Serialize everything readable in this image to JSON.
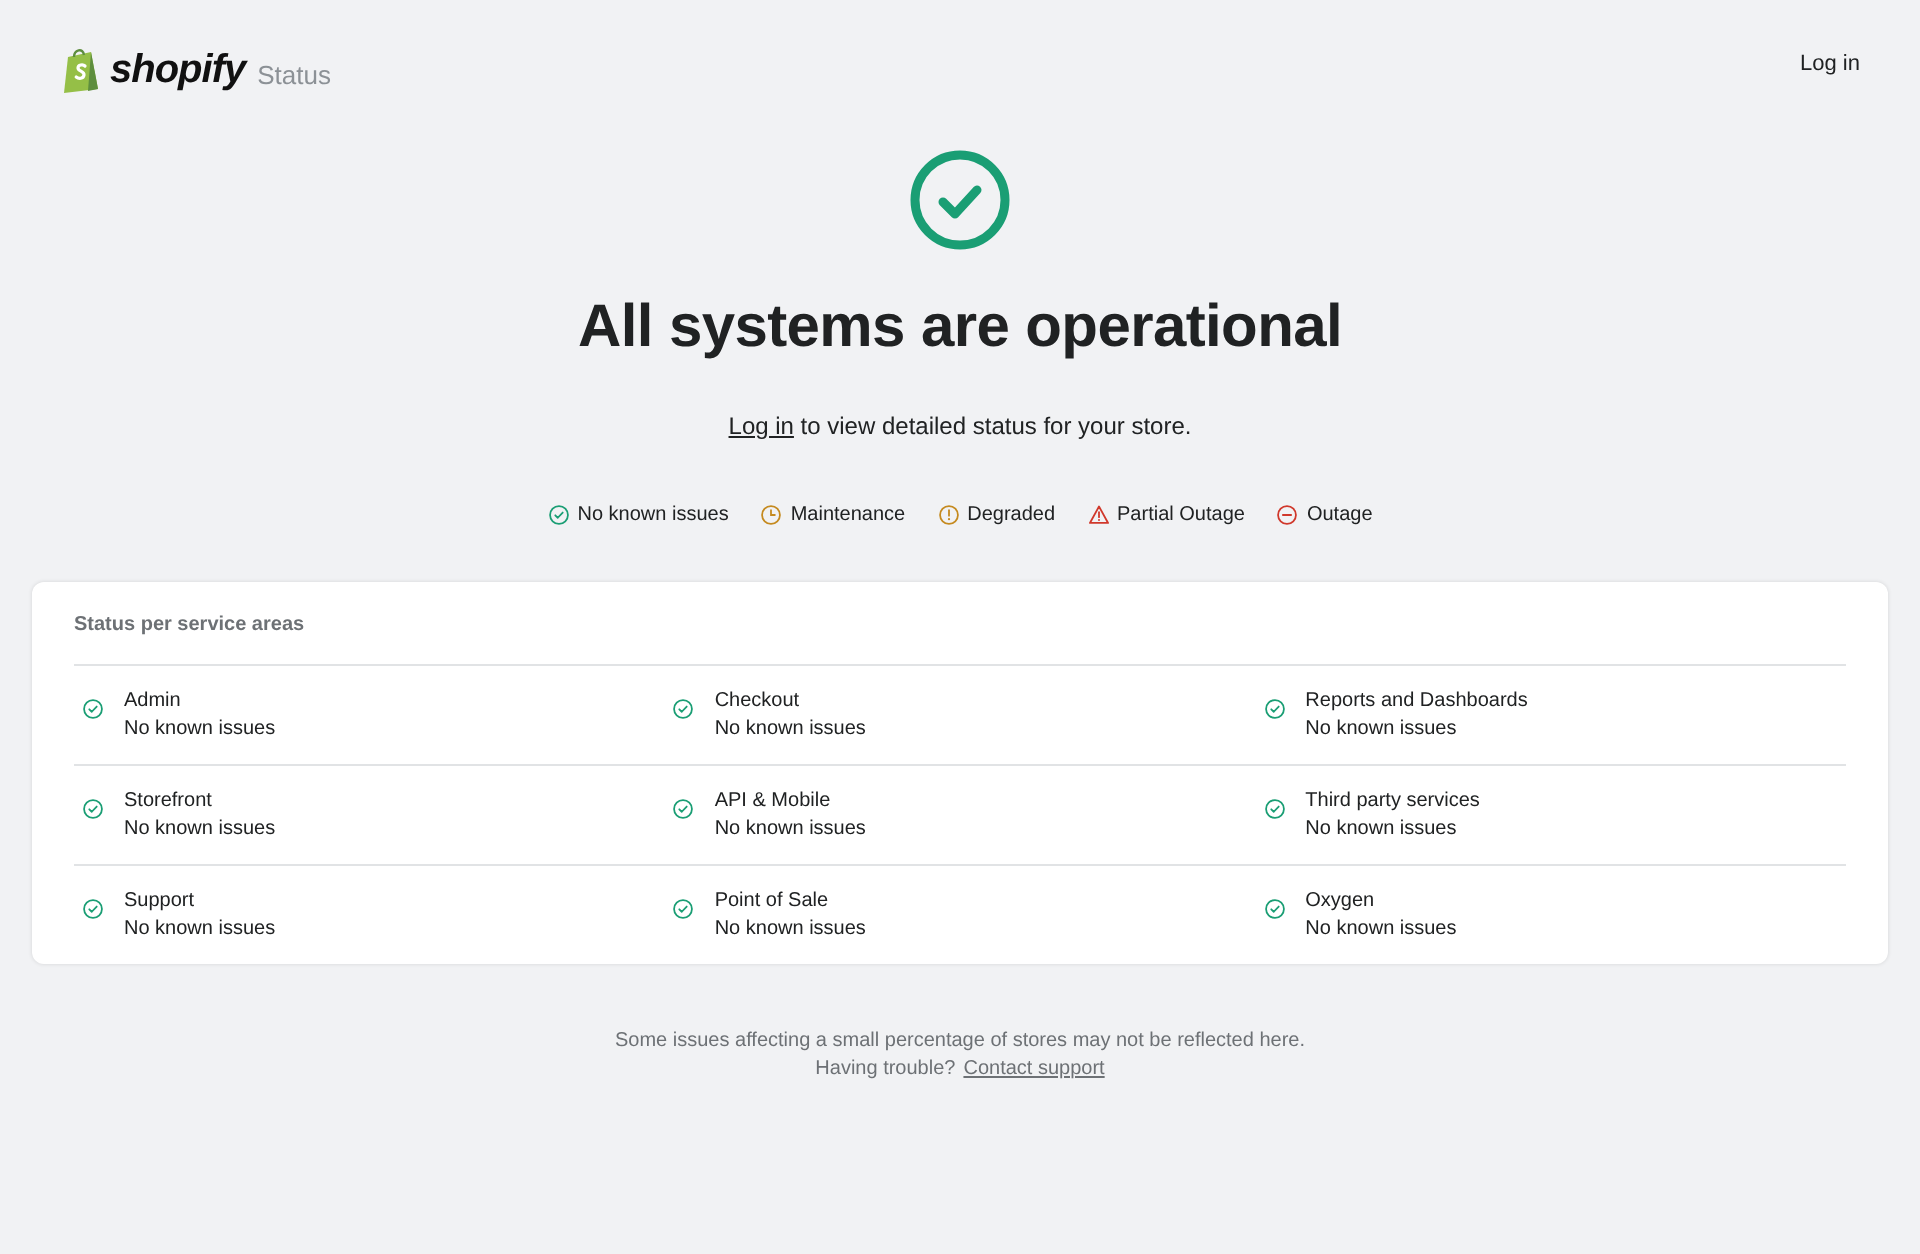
{
  "header": {
    "logo": "shopify",
    "subtitle": "Status",
    "login": "Log in"
  },
  "hero": {
    "kind": "ok",
    "title": "All systems are operational",
    "link": "Log in",
    "text": " to view detailed status for your store."
  },
  "legend": [
    {
      "kind": "ok",
      "label": "No known issues"
    },
    {
      "kind": "maintenance",
      "label": "Maintenance"
    },
    {
      "kind": "degraded",
      "label": "Degraded"
    },
    {
      "kind": "partial",
      "label": "Partial Outage"
    },
    {
      "kind": "outage",
      "label": "Outage"
    }
  ],
  "services": {
    "title": "Status per service areas",
    "items": [
      {
        "name": "Admin",
        "kind": "ok",
        "text": "No known issues"
      },
      {
        "name": "Checkout",
        "kind": "ok",
        "text": "No known issues"
      },
      {
        "name": "Reports and Dashboards",
        "kind": "ok",
        "text": "No known issues"
      },
      {
        "name": "Storefront",
        "kind": "ok",
        "text": "No known issues"
      },
      {
        "name": "API & Mobile",
        "kind": "ok",
        "text": "No known issues"
      },
      {
        "name": "Third party services",
        "kind": "ok",
        "text": "No known issues"
      },
      {
        "name": "Support",
        "kind": "ok",
        "text": "No known issues"
      },
      {
        "name": "Point of Sale",
        "kind": "ok",
        "text": "No known issues"
      },
      {
        "name": "Oxygen",
        "kind": "ok",
        "text": "No known issues"
      }
    ]
  },
  "footer": {
    "note": "Some issues affecting a small percentage of stores may not be reflected here.",
    "question": "Having trouble?",
    "link": "Contact support"
  }
}
